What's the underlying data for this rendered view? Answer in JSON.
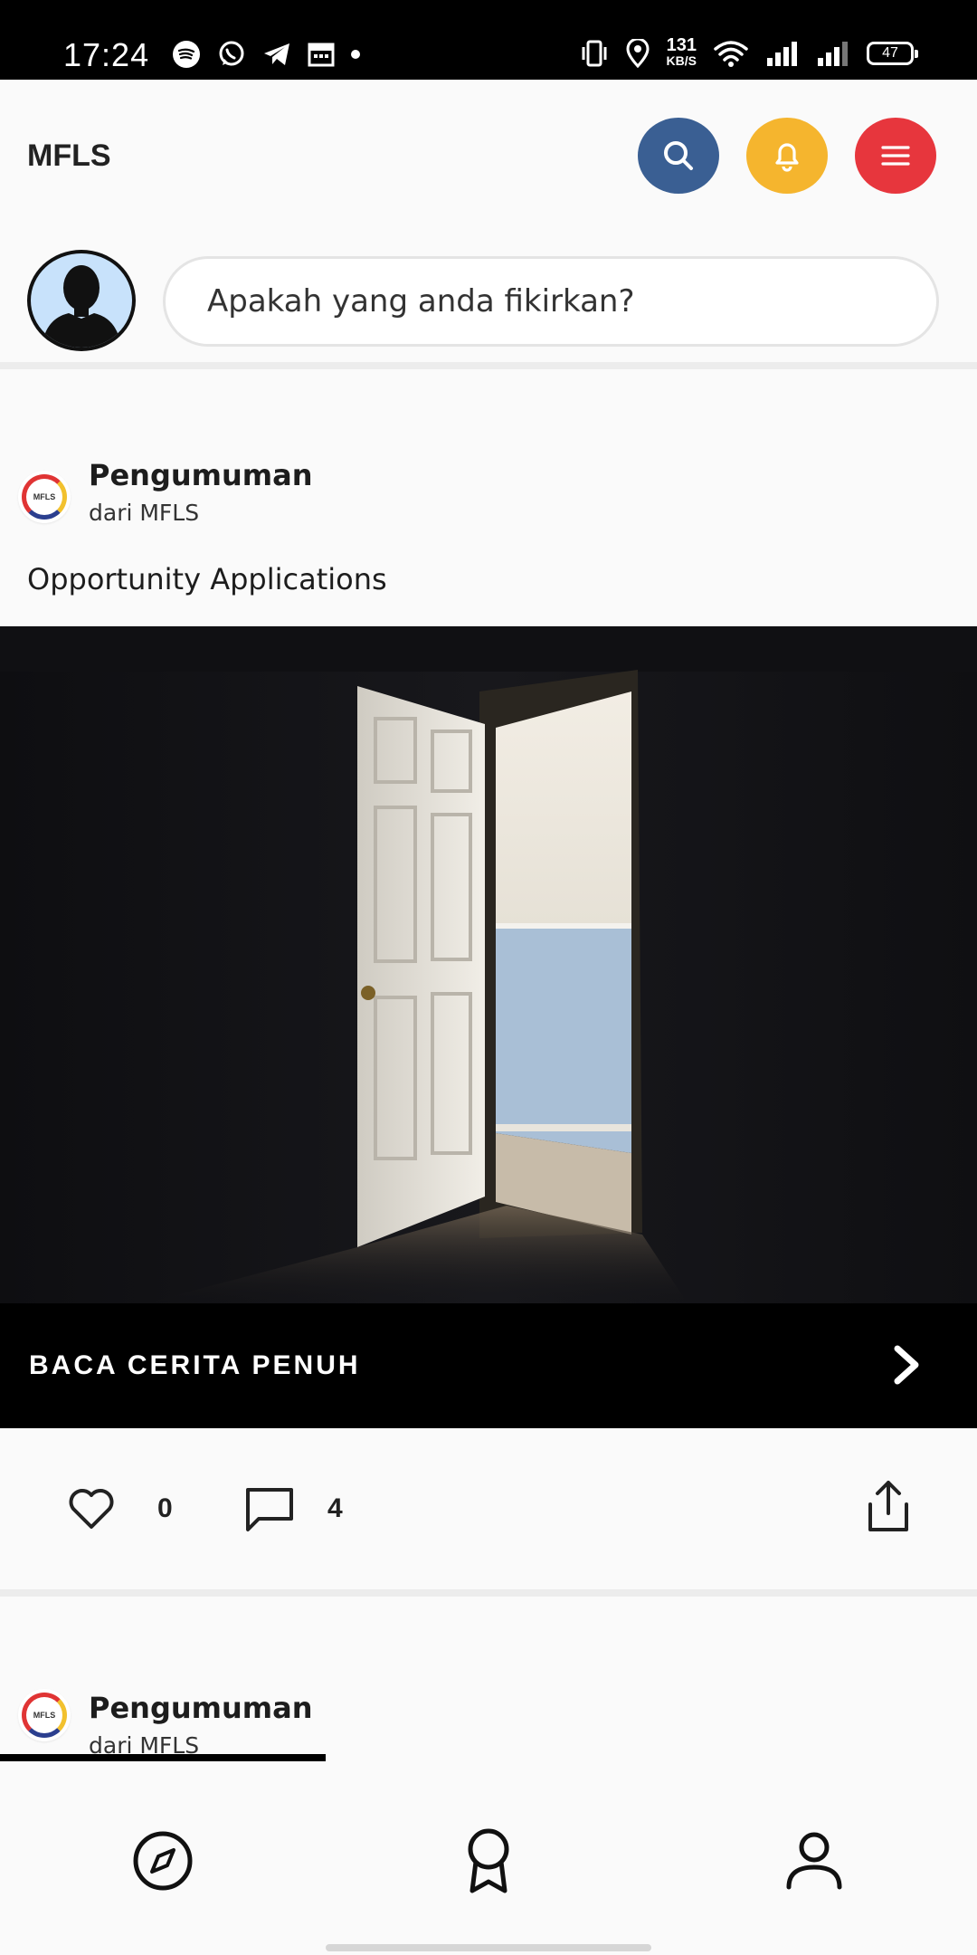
{
  "status_bar": {
    "time": "17:24",
    "net_speed": "131",
    "net_unit": "KB/S",
    "battery": "47",
    "icons_left": [
      "spotify-icon",
      "whatsapp-icon",
      "telegram-icon",
      "calendar-icon",
      "dot-icon"
    ],
    "icons_right": [
      "vibrate-icon",
      "location-icon",
      "wifi-icon",
      "signal-icon",
      "signal-icon",
      "battery-icon"
    ]
  },
  "header": {
    "title": "MFLS",
    "buttons": [
      {
        "icon": "search-icon",
        "color": "#3a5f93"
      },
      {
        "icon": "bell-icon",
        "color": "#f5b52e"
      },
      {
        "icon": "menu-icon",
        "color": "#e7363d"
      }
    ]
  },
  "composer": {
    "placeholder": "Apakah yang anda fikirkan?"
  },
  "post": {
    "title": "Pengumuman",
    "subtitle": "dari MFLS",
    "text": "Opportunity Applications",
    "logo_text": "MFLS",
    "read_more": "BACA CERITA PENUH",
    "likes": "0",
    "comments": "4"
  },
  "next_post": {
    "title": "Pengumuman",
    "subtitle": "dari MFLS",
    "logo_text": "MFLS"
  },
  "bottom_nav": {
    "items": [
      "compass-icon",
      "award-icon",
      "profile-icon"
    ]
  }
}
